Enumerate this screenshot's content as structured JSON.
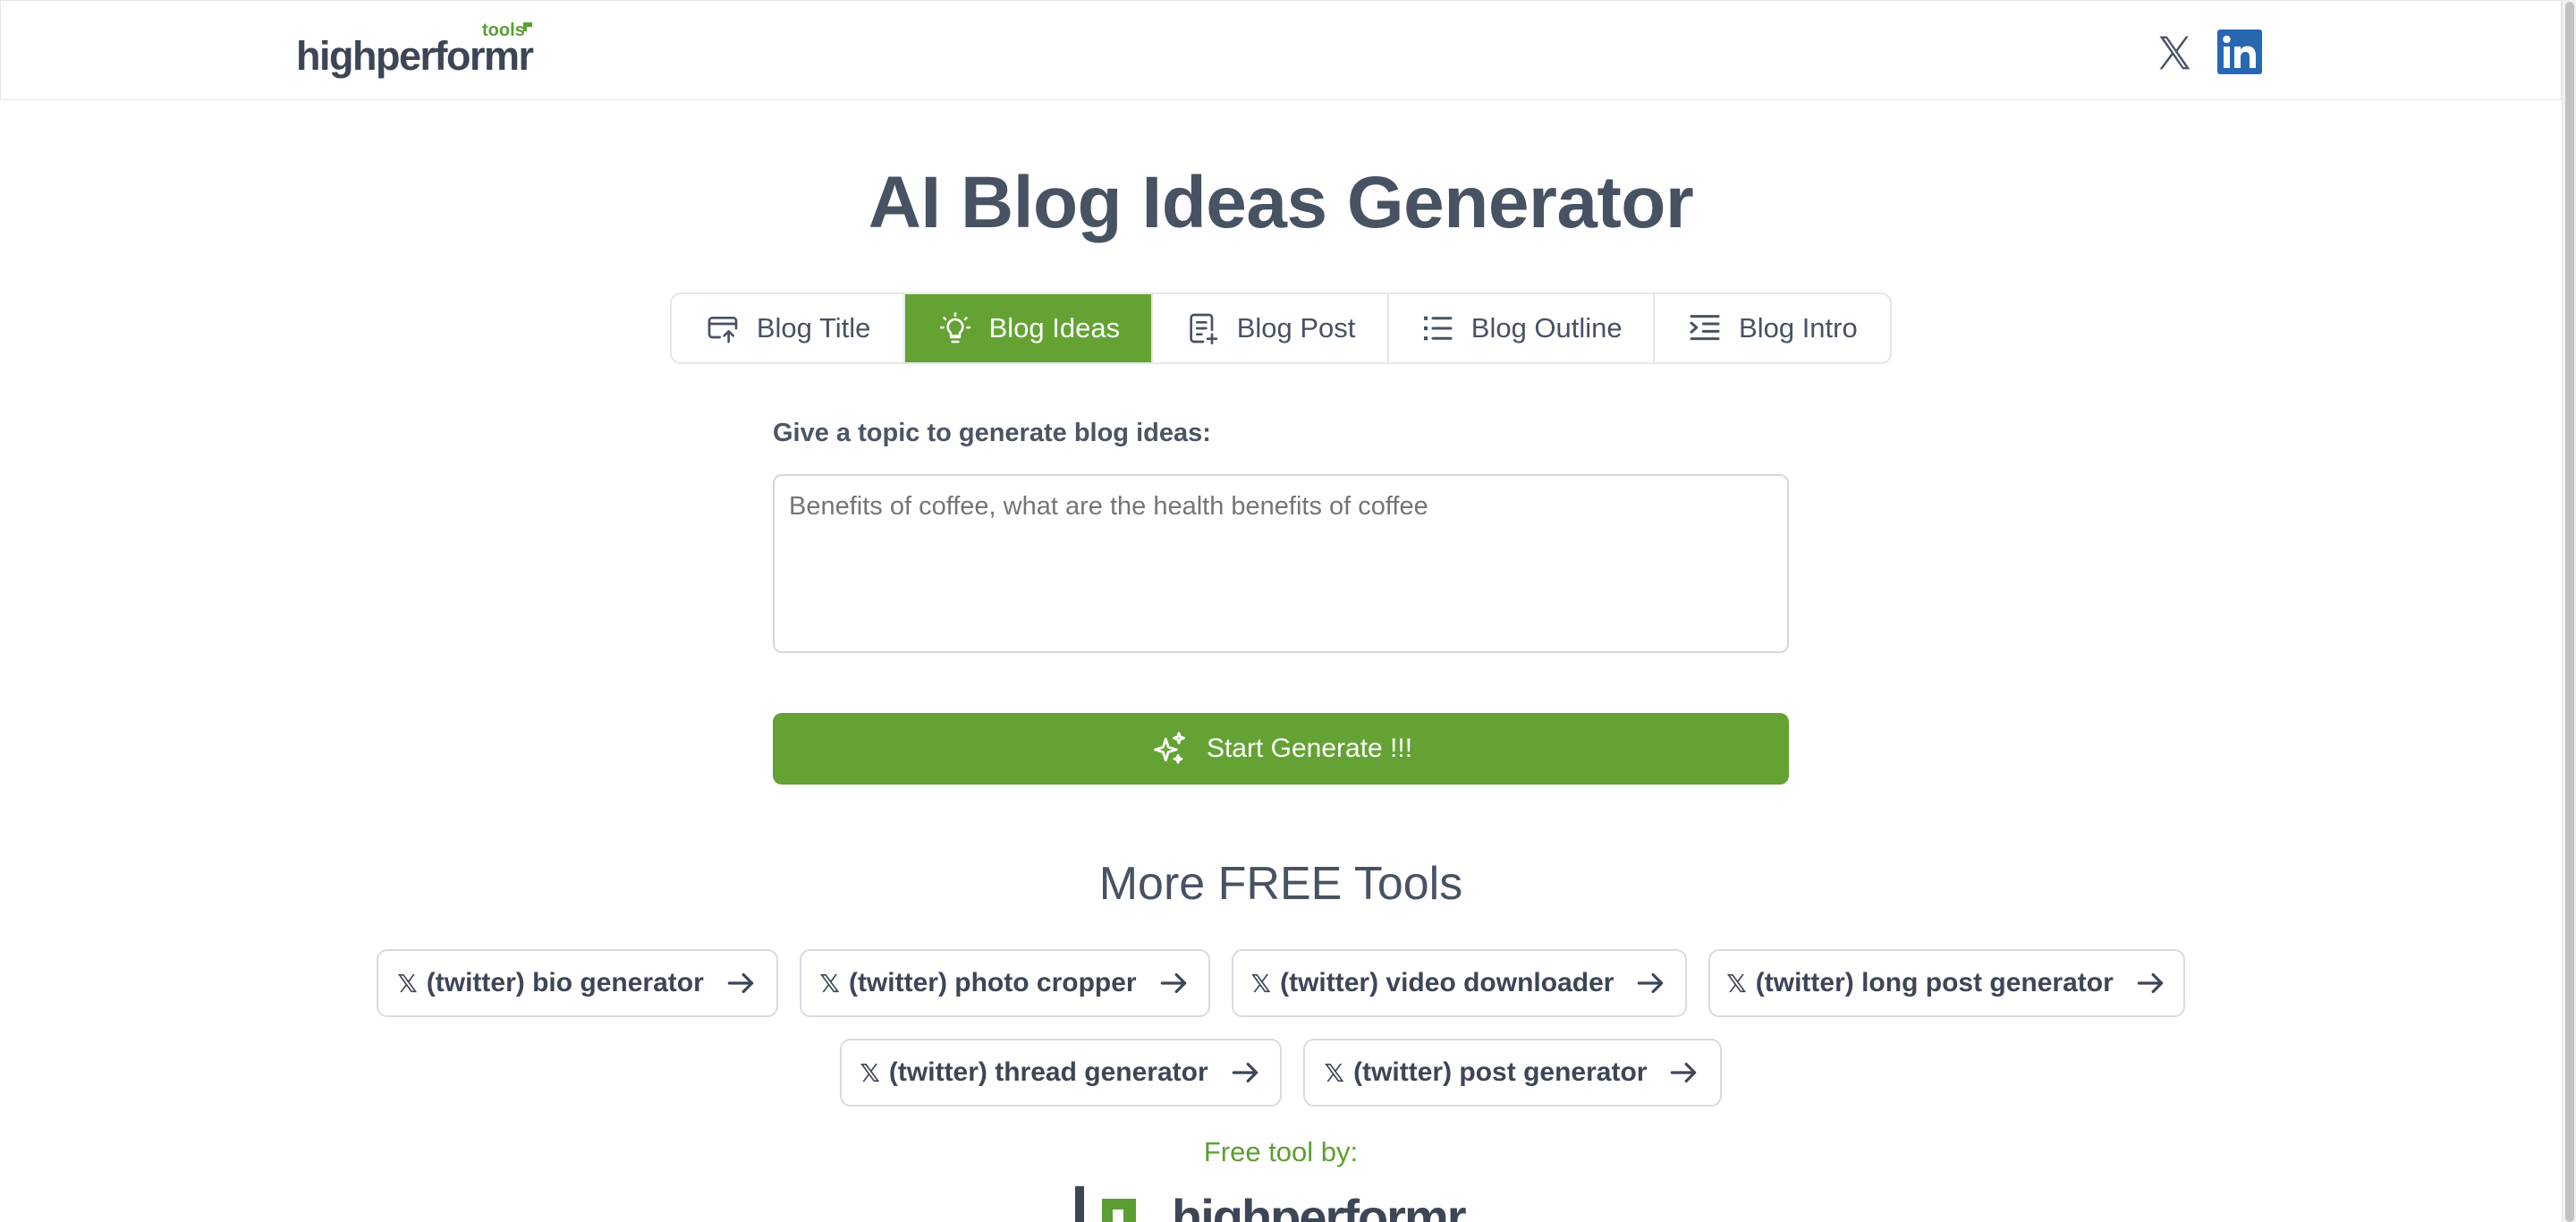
{
  "header": {
    "logo_text": "highperformr",
    "logo_badge": "tools",
    "social": [
      {
        "name": "x",
        "icon": "x-logo-icon"
      },
      {
        "name": "linkedin",
        "icon": "linkedin-icon"
      }
    ]
  },
  "page_title": "AI Blog Ideas Generator",
  "tabs": [
    {
      "label": "Blog Title",
      "icon": "card-upload-icon",
      "active": false
    },
    {
      "label": "Blog Ideas",
      "icon": "lightbulb-icon",
      "active": true
    },
    {
      "label": "Blog Post",
      "icon": "document-add-icon",
      "active": false
    },
    {
      "label": "Blog Outline",
      "icon": "list-icon",
      "active": false
    },
    {
      "label": "Blog Intro",
      "icon": "text-indent-icon",
      "active": false
    }
  ],
  "form": {
    "label": "Give a topic to generate blog ideas:",
    "placeholder": "Benefits of coffee, what are the health benefits of coffee",
    "value": "",
    "submit_label": "Start Generate !!!"
  },
  "more_tools": {
    "title": "More FREE Tools",
    "items": [
      {
        "prefix": "𝕏",
        "label": "(twitter) bio generator"
      },
      {
        "prefix": "𝕏",
        "label": "(twitter) photo cropper"
      },
      {
        "prefix": "𝕏",
        "label": "(twitter) video downloader"
      },
      {
        "prefix": "𝕏",
        "label": "(twitter) long post generator"
      },
      {
        "prefix": "𝕏",
        "label": "(twitter) thread generator"
      },
      {
        "prefix": "𝕏",
        "label": "(twitter) post generator"
      }
    ]
  },
  "footer": {
    "free_tool_by": "Free tool by:",
    "logo_text": "highperformr"
  },
  "colors": {
    "accent": "#64a233",
    "text": "#475263",
    "border": "#e5e7eb"
  }
}
